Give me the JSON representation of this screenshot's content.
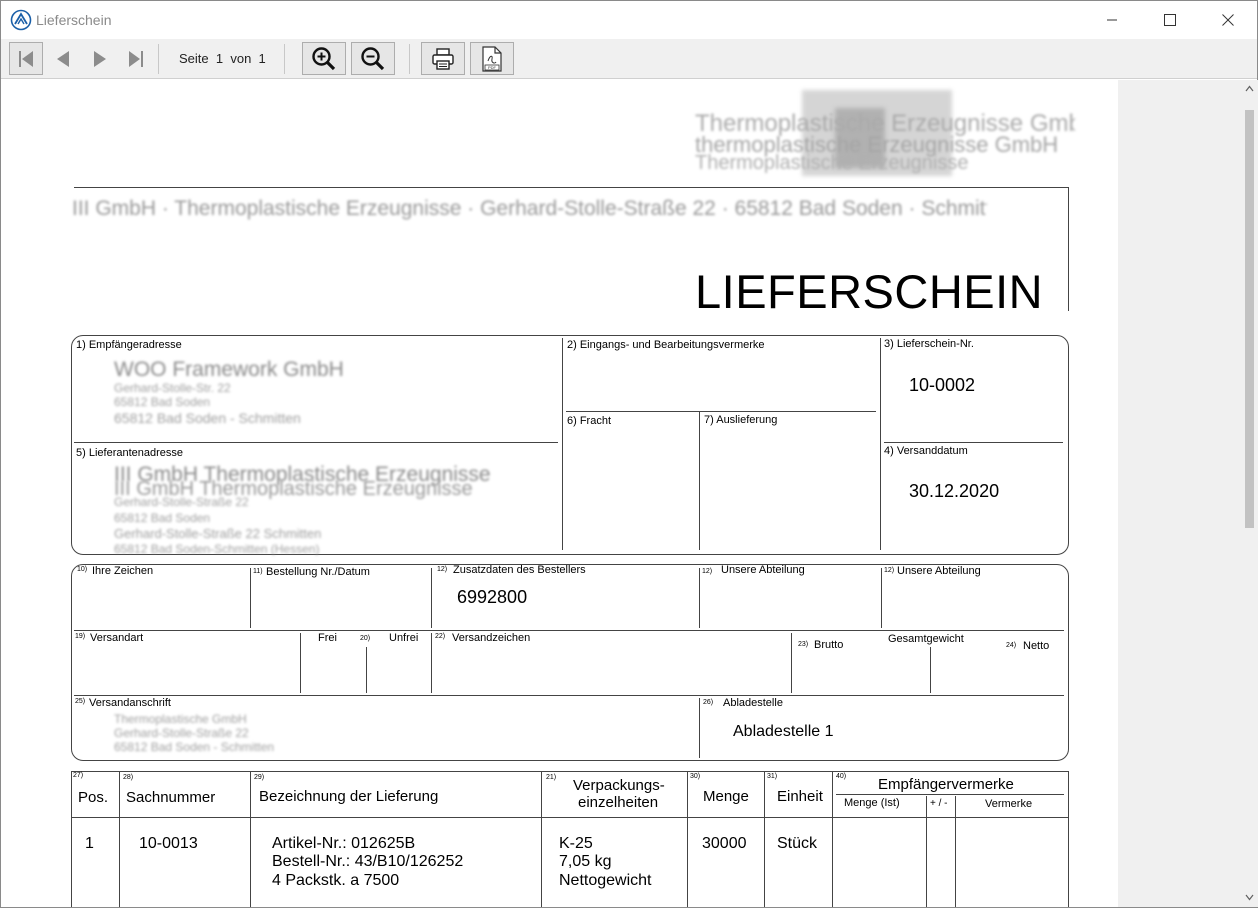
{
  "window": {
    "title": "Lieferschein"
  },
  "toolbar": {
    "page_prefix": "Seite",
    "page_current": "1",
    "page_sep": "von",
    "page_total": "1"
  },
  "doc": {
    "letterhead_line1": "Thermoplastische Erzeugnisse GmbH Elektro",
    "letterhead_line2": "thermoplastische Erzeugnisse GmbH",
    "letterhead_line3": "Thermoplastische Erzeugnisse",
    "sender_line": "III GmbH · Thermoplastische Erzeugnisse · Gerhard-Stolle-Straße 22 · 65812 Bad Soden · Schmitten",
    "title": "LIEFERSCHEIN",
    "f1_label": "1) Empfängeradresse",
    "f1_name": "WOO Framework GmbH",
    "f1_l2": "Gerhard-Stolle-Str. 22",
    "f1_l3": "65812 Bad Soden",
    "f1_l4": "65812 Bad Soden - Schmitten",
    "f2_label": "2) Eingangs- und Bearbeitungsvermerke",
    "f3_label": "3) Lieferschein-Nr.",
    "f3_value": "10-0002",
    "f4_label": "4) Versanddatum",
    "f4_value": "30.12.2020",
    "f5_label": "5) Lieferantenadresse",
    "f5_name": "III GmbH Thermoplastische Erzeugnisse",
    "f5_name2": "III GmbH Thermoplastische Erzeugnisse",
    "f5_l2": "Gerhard-Stolle-Straße 22",
    "f5_l3": "65812 Bad Soden",
    "f5_l4": "Gerhard-Stolle-Straße 22 Schmitten",
    "f5_l5": "65812 Bad Soden-Schmitten (Hessen)",
    "f6_label": "6) Fracht",
    "f7_label": "7) Auslieferung",
    "n10": "10)",
    "f10_label": "Ihre Zeichen",
    "n11": "11)",
    "f11_label": "Bestellung Nr./Datum",
    "n12a": "12)",
    "f12a_label": "Zusatzdaten des Bestellers",
    "f12a_value": "6992800",
    "n12b": "12)",
    "f12b_label": "Unsere Abteilung",
    "n12c": "12)",
    "f12c_label": "Unsere Abteilung",
    "n19": "19)",
    "f19_label": "Versandart",
    "f_frei": "Frei",
    "n20": "20)",
    "f20_label": "Unfrei",
    "n22": "22)",
    "f22_label": "Versandzeichen",
    "n23": "23)",
    "f23_label": "Brutto",
    "f_gesamt": "Gesamtgewicht",
    "n24": "24)",
    "f24_label": "Netto",
    "n25": "25)",
    "f25_label": "Versandanschrift",
    "f25_l1": "Thermoplastische GmbH",
    "f25_l2": "Gerhard-Stolle-Straße 22",
    "f25_l3": "65812 Bad Soden - Schmitten",
    "n26": "26)",
    "f26_label": "Abladestelle",
    "f26_value": "Abladestelle 1",
    "table": {
      "n27": "27)",
      "h_pos": "Pos.",
      "n28": "28)",
      "h_sach": "Sachnummer",
      "n29": "29)",
      "h_bez": "Bezeichnung der Lieferung",
      "n21": "21)",
      "h_verp1": "Verpackungs-",
      "h_verp2": "einzelheiten",
      "n30": "30)",
      "h_menge": "Menge",
      "n31": "31)",
      "h_einheit": "Einheit",
      "n40": "40)",
      "h_empf": "Empfängervermerke",
      "h_mist": "Menge (Ist)",
      "h_pm": "+ / -",
      "h_verm": "Vermerke",
      "row": {
        "pos": "1",
        "sach": "10-0013",
        "bez1": "Artikel-Nr.: 012625B",
        "bez2": "Bestell-Nr.: 43/B10/126252",
        "bez3": "4 Packstk. a 7500",
        "verp1": "K-25",
        "verp2": "7,05 kg",
        "verp3": "Nettogewicht",
        "menge": "30000",
        "einheit": "Stück"
      }
    }
  }
}
